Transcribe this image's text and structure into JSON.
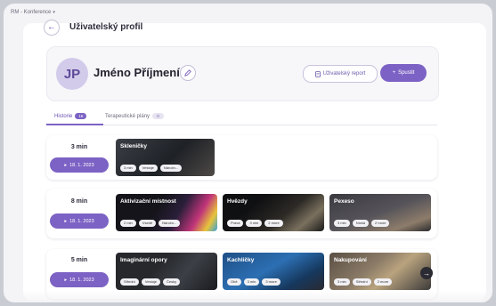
{
  "window": {
    "title": "RM - Konference"
  },
  "header": {
    "page_title": "Uživatelský profil"
  },
  "profile": {
    "initials": "JP",
    "name": "Jméno Příjmení",
    "report_label": "Uživatelský report",
    "start_label": "Spustit"
  },
  "tabs": [
    {
      "label": "Historie",
      "count": "16"
    },
    {
      "label": "Terapeutické plány",
      "count": "0"
    }
  ],
  "sessions": [
    {
      "duration": "3 min",
      "date": "18. 1. 2023",
      "games": [
        {
          "title": "Skleničky",
          "tags": [
            "3 min",
            "Vestoje",
            "Náročn..."
          ]
        }
      ]
    },
    {
      "duration": "8 min",
      "date": "18. 1. 2023",
      "games": [
        {
          "title": "Aktivizační místnost",
          "tags": [
            "2 min",
            "Vsedě",
            "Náročn..."
          ]
        },
        {
          "title": "Hvězdy",
          "tags": [
            "Pravá",
            "3 min",
            "2 more"
          ]
        },
        {
          "title": "Pexeso",
          "tags": [
            "3 min",
            "Nízká",
            "2 more"
          ]
        }
      ]
    },
    {
      "duration": "5 min",
      "date": "18. 1. 2023",
      "games": [
        {
          "title": "Imaginární opory",
          "tags": [
            "Střední",
            "Vestoje",
            "Česky"
          ]
        },
        {
          "title": "Kachličky",
          "tags": [
            "Obě",
            "3 min",
            "3 more"
          ]
        },
        {
          "title": "Nakupování",
          "tags": [
            "3 min",
            "Střední",
            "2 more"
          ]
        }
      ]
    }
  ],
  "icons": {
    "back": "arrow-left-icon",
    "edit": "pencil-icon",
    "report": "document-icon",
    "start": "plus-icon",
    "play": "play-icon",
    "next": "arrow-right-icon"
  },
  "colors": {
    "accent": "#7c62c4",
    "avatar_bg": "#d3cbea"
  }
}
